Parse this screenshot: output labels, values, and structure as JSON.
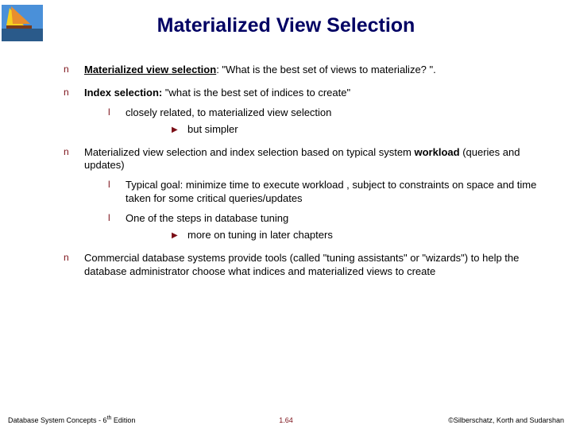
{
  "title": "Materialized View Selection",
  "bullets": {
    "b1_bold": "Materialized view selection",
    "b1_rest": ": \"What is the best set of views to materialize? \".",
    "b2_bold": "Index selection:",
    "b2_rest": "  \"what is  the best set of indices to create\"",
    "b2_sub1": "closely related, to materialized view selection",
    "b2_sub1_a": "but simpler",
    "b3_pre": "Materialized view selection and index selection based on typical system ",
    "b3_bold": "workload",
    "b3_post": " (queries and updates)",
    "b3_sub1": "Typical goal: minimize time to execute workload , subject to constraints on space and time taken for some critical queries/updates",
    "b3_sub2": "One of the steps in database tuning",
    "b3_sub2_a": "more on tuning in later chapters",
    "b4": "Commercial database systems provide tools (called \"tuning assistants\" or \"wizards\") to help the database administrator choose what indices and materialized views to create"
  },
  "footer": {
    "left_pre": "Database System Concepts - 6",
    "left_sup": "th",
    "left_post": " Edition",
    "mid": "1.64",
    "right": "©Silberschatz, Korth and Sudarshan"
  }
}
